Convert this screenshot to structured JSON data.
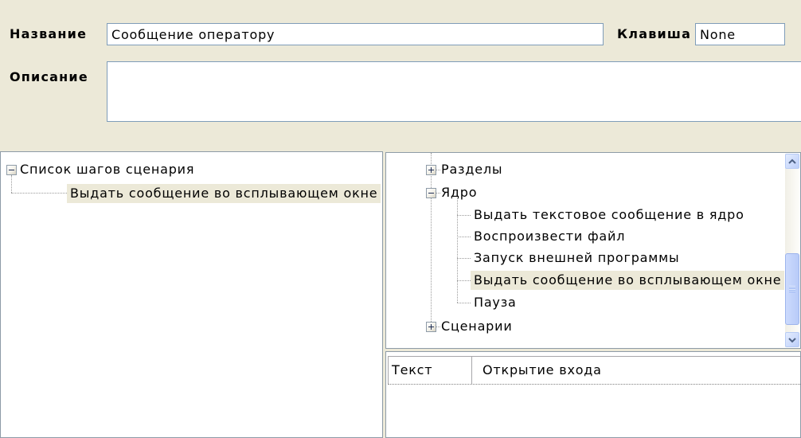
{
  "colors": {
    "window_bg": "#ECE9D8",
    "panel_bg": "#FFFFFF",
    "selection_bg": "#ECE9D8",
    "input_border": "#7F9DB9",
    "tree_line": "#9A9A9A"
  },
  "icons": {
    "expand": "expand-icon",
    "collapse": "collapse-icon",
    "scroll_up": "chevron-up-icon",
    "scroll_down": "chevron-down-icon"
  },
  "form": {
    "name": {
      "label": "Название",
      "value": "Сообщение оператору"
    },
    "hotkey": {
      "label": "Клавиша",
      "value": "None"
    },
    "description": {
      "label": "Описание",
      "value": ""
    }
  },
  "steps_tree": {
    "root": {
      "label": "Список шагов сценария",
      "expanded": true
    },
    "items": [
      {
        "label": "Выдать сообщение во всплывающем окне",
        "selected": true
      }
    ]
  },
  "actions_tree": {
    "nodes": [
      {
        "label": "Разделы",
        "expanded": false
      },
      {
        "label": "Ядро",
        "expanded": true,
        "children": [
          {
            "label": "Выдать текстовое сообщение в ядро",
            "selected": false
          },
          {
            "label": "Воспроизвести файл",
            "selected": false
          },
          {
            "label": "Запуск внешней программы",
            "selected": false
          },
          {
            "label": "Выдать сообщение во всплывающем окне",
            "selected": true
          },
          {
            "label": "Пауза",
            "selected": false
          }
        ]
      },
      {
        "label": "Сценарии",
        "expanded": false
      }
    ]
  },
  "properties": {
    "rows": [
      {
        "name": "Текст",
        "value": "Открытие входа"
      }
    ]
  }
}
